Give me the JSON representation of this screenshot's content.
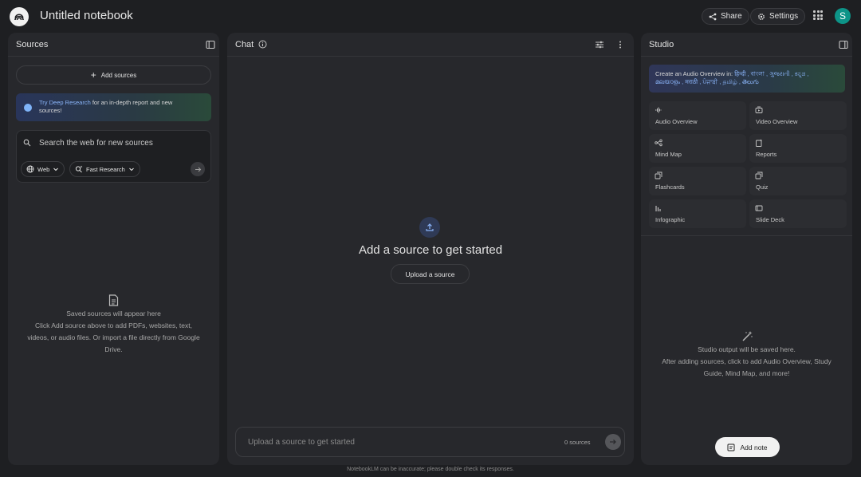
{
  "app": {
    "title": "Untitled notebook"
  },
  "header": {
    "share_label": "Share",
    "settings_label": "Settings",
    "avatar_letter": "S"
  },
  "sources": {
    "title": "Sources",
    "add_sources_label": "Add sources",
    "deep_research": {
      "link_text": "Try Deep Research",
      "text_1": " for an in-depth report and new",
      "text_2": "sources!"
    },
    "search_placeholder": "Search the web for new sources",
    "web_chip": "Web",
    "research_chip": "Fast Research",
    "empty_title": "Saved sources will appear here",
    "empty_line_1": "Click Add source above to add PDFs, websites, text,",
    "empty_line_2": "videos, or audio files. Or import a file directly from Google",
    "empty_line_3": "Drive."
  },
  "chat": {
    "title": "Chat",
    "headline": "Add a source to get started",
    "upload_label": "Upload a source",
    "input_placeholder": "Upload a source to get started",
    "source_count": "0 sources"
  },
  "studio": {
    "title": "Studio",
    "lang_banner_prefix": "Create an Audio Overview in: ",
    "lang_banner_line_1": "हिन्दी , বাংলা , ગુજરાતી , ಕನ್ನಡ ,",
    "lang_banner_line_2": "മലയാളം , मराठी , ਪੰਜਾਬੀ , தமிழ் , తెలుగు",
    "tiles": [
      {
        "label": "Audio Overview",
        "icon": "audio-waveform-icon"
      },
      {
        "label": "Video Overview",
        "icon": "video-icon"
      },
      {
        "label": "Mind Map",
        "icon": "mind-map-icon"
      },
      {
        "label": "Reports",
        "icon": "reports-icon"
      },
      {
        "label": "Flashcards",
        "icon": "flashcards-icon"
      },
      {
        "label": "Quiz",
        "icon": "quiz-icon"
      },
      {
        "label": "Infographic",
        "icon": "infographic-icon"
      },
      {
        "label": "Slide Deck",
        "icon": "slide-deck-icon"
      }
    ],
    "empty_title": "Studio output will be saved here.",
    "empty_line_1": "After adding sources, click to add Audio Overview, Study",
    "empty_line_2": "Guide, Mind Map, and more!",
    "add_note_label": "Add note"
  },
  "footer": {
    "disclaimer": "NotebookLM can be inaccurate; please double check its responses."
  },
  "colors": {
    "background": "#1e1f22",
    "panel": "#27282c",
    "accent_link": "#8ab4f8",
    "avatar": "#0d9488"
  }
}
